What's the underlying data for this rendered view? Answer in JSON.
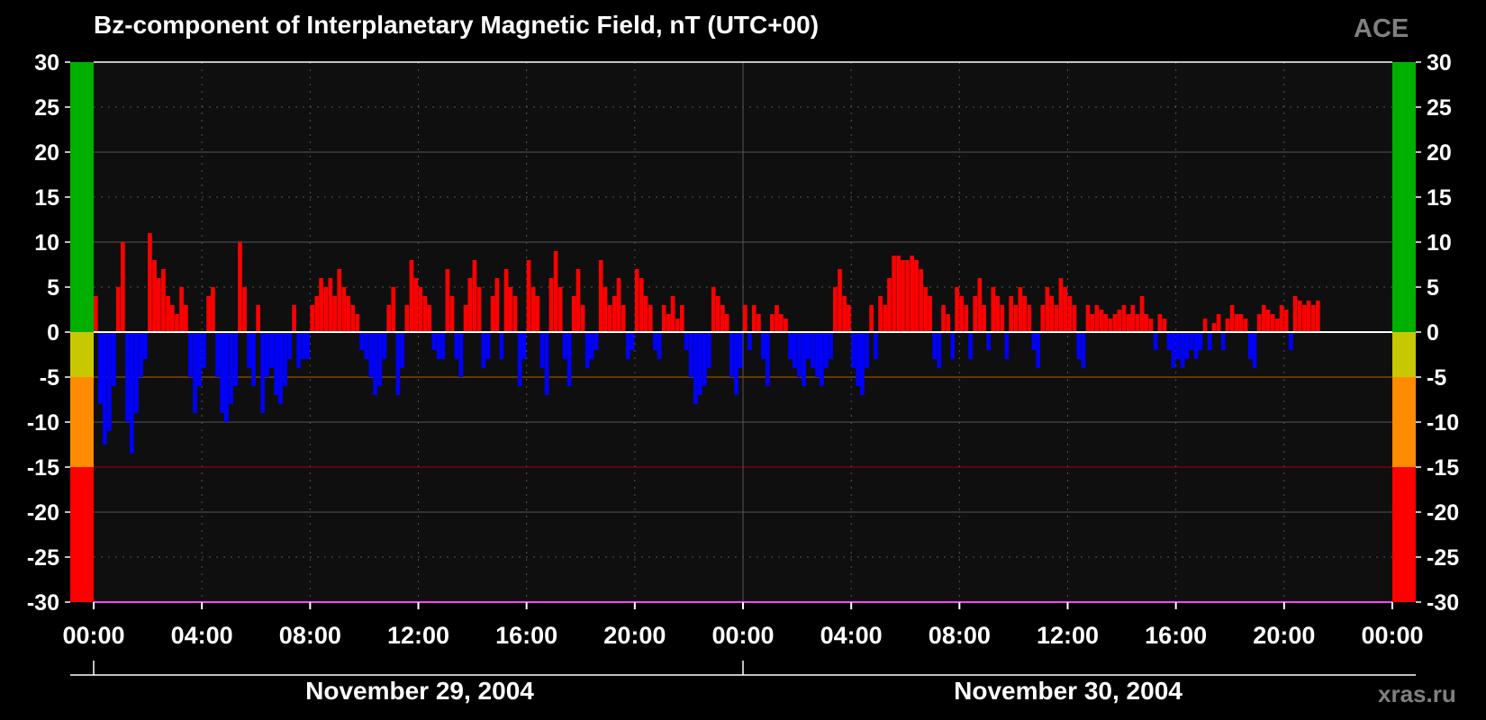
{
  "header": {
    "title": "Bz-component of Interplanetary Magnetic Field, nT (UTC+00)",
    "source": "ACE"
  },
  "footer": {
    "credit": "xras.ru"
  },
  "colors": {
    "background": "#000000",
    "plot_background": "#0f0f0f",
    "positive": "#ff0000",
    "negative": "#0000ff",
    "zero_line": "#ffffff",
    "grid": "#555555",
    "band_quiet": "#00b000",
    "band_weak": "#c8c800",
    "band_moderate": "#ff8c00",
    "band_strong": "#ff0000",
    "threshold_minus5": "#b06000",
    "threshold_minus15": "#a00000",
    "muted_text": "#808080"
  },
  "chart_data": {
    "type": "bar",
    "title": "Bz-component of Interplanetary Magnetic Field, nT (UTC+00)",
    "ylabel": "",
    "xlabel": "",
    "ylim": [
      -30,
      30
    ],
    "yticks": [
      "30",
      "25",
      "20",
      "15",
      "10",
      "5",
      "0",
      "-5",
      "-10",
      "-15",
      "-20",
      "-25",
      "-30"
    ],
    "y_tick_values": [
      30,
      25,
      20,
      15,
      10,
      5,
      0,
      -5,
      -10,
      -15,
      -20,
      -25,
      -30
    ],
    "xlim_hours": [
      0,
      48
    ],
    "xticks": [
      "00:00",
      "04:00",
      "08:00",
      "12:00",
      "16:00",
      "20:00",
      "00:00",
      "04:00",
      "08:00",
      "12:00",
      "16:00",
      "20:00",
      "00:00"
    ],
    "x_tick_hours": [
      0,
      4,
      8,
      12,
      16,
      20,
      24,
      28,
      32,
      36,
      40,
      44,
      48
    ],
    "dates": [
      {
        "label": "November 29, 2004",
        "start_hour": 0,
        "end_hour": 24
      },
      {
        "label": "November 30, 2004",
        "start_hour": 24,
        "end_hour": 48
      }
    ],
    "threshold_bands": [
      {
        "from": 0,
        "to": 30,
        "color": "#00b000"
      },
      {
        "from": -5,
        "to": 0,
        "color": "#c8c800"
      },
      {
        "from": -15,
        "to": -5,
        "color": "#ff8c00"
      },
      {
        "from": -30,
        "to": -15,
        "color": "#ff0000"
      }
    ],
    "grid": true,
    "legend": "none",
    "interval_minutes": 10,
    "series": [
      {
        "x_hours": [
          0.0,
          0.17,
          0.33,
          0.5,
          0.67,
          0.83,
          1.0,
          1.17,
          1.33,
          1.5,
          1.67,
          1.83,
          2.0,
          2.17,
          2.33,
          2.5,
          2.67,
          2.83,
          3.0,
          3.17,
          3.33,
          3.5,
          3.67,
          3.83,
          4.0,
          4.17,
          4.33,
          4.5,
          4.67,
          4.83,
          5.0,
          5.17,
          5.33,
          5.5,
          5.67,
          5.83,
          6.0,
          6.17,
          6.33,
          6.5,
          6.67,
          6.83,
          7.0,
          7.17,
          7.33,
          7.5,
          7.67,
          7.83,
          8.0,
          8.17,
          8.33,
          8.5,
          8.67,
          8.83,
          9.0,
          9.17,
          9.33,
          9.5,
          9.67,
          9.83,
          10.0,
          10.17,
          10.33,
          10.5,
          10.67,
          10.83,
          11.0,
          11.17,
          11.33,
          11.5,
          11.67,
          11.83,
          12.0,
          12.17,
          12.33,
          12.5,
          12.67,
          12.83,
          13.0,
          13.17,
          13.33,
          13.5,
          13.67,
          13.83,
          14.0,
          14.17,
          14.33,
          14.5,
          14.67,
          14.83,
          15.0,
          15.17,
          15.33,
          15.5,
          15.67,
          15.83,
          16.0,
          16.17,
          16.33,
          16.5,
          16.67,
          16.83,
          17.0,
          17.17,
          17.33,
          17.5,
          17.67,
          17.83,
          18.0,
          18.17,
          18.33,
          18.5,
          18.67,
          18.83,
          19.0,
          19.17,
          19.33,
          19.5,
          19.67,
          19.83,
          20.0,
          20.17,
          20.33,
          20.5,
          20.67,
          20.83,
          21.0,
          21.17,
          21.33,
          21.5,
          21.67,
          21.83,
          22.0,
          22.17,
          22.33,
          22.5,
          22.67,
          22.83,
          23.0,
          23.17,
          23.33,
          23.5,
          23.67,
          23.83,
          24.0,
          24.17,
          24.33,
          24.5,
          24.67,
          24.83,
          25.0,
          25.17,
          25.33,
          25.5,
          25.67,
          25.83,
          26.0,
          26.17,
          26.33,
          26.5,
          26.67,
          26.83,
          27.0,
          27.17,
          27.33,
          27.5,
          27.67,
          27.83,
          28.0,
          28.17,
          28.33,
          28.5,
          28.67,
          28.83,
          29.0,
          29.17,
          29.33,
          29.5,
          29.67,
          29.83,
          30.0,
          30.17,
          30.33,
          30.5,
          30.67,
          30.83,
          31.0,
          31.17,
          31.33,
          31.5,
          31.67,
          31.83,
          32.0,
          32.17,
          32.33,
          32.5,
          32.67,
          32.83,
          33.0,
          33.17,
          33.33,
          33.5,
          33.67,
          33.83,
          34.0,
          34.17,
          34.33,
          34.5,
          34.67,
          34.83,
          35.0,
          35.17,
          35.33,
          35.5,
          35.67,
          35.83,
          36.0,
          36.17,
          36.33,
          36.5,
          36.67,
          36.83,
          37.0,
          37.17,
          37.33,
          37.5,
          37.67,
          37.83,
          38.0,
          38.17,
          38.33,
          38.5,
          38.67,
          38.83,
          39.0,
          39.17,
          39.33,
          39.5,
          39.67,
          39.83,
          40.0,
          40.17,
          40.33,
          40.5,
          40.67,
          40.83,
          41.0,
          41.17,
          41.33,
          41.5,
          41.67,
          41.83,
          42.0,
          42.17,
          42.33,
          42.5,
          42.67,
          42.83,
          43.0,
          43.17,
          43.33,
          43.5,
          43.67,
          43.83,
          44.0,
          44.17,
          44.33,
          44.5,
          44.67,
          44.83,
          45.0,
          45.17,
          45.33,
          45.5,
          45.67,
          45.83,
          46.0,
          46.17,
          46.33,
          46.5,
          46.67,
          46.83,
          47.0,
          47.17,
          47.33,
          47.5,
          47.67,
          47.83
        ],
        "bz": [
          4.0,
          -8.0,
          -12.5,
          -11.0,
          -6.0,
          5.0,
          10.0,
          -10.0,
          -13.5,
          -9.0,
          -5.0,
          -3.0,
          11.0,
          8.0,
          6.0,
          7.0,
          4.0,
          3.0,
          2.0,
          5.0,
          3.0,
          -5.0,
          -9.0,
          -6.0,
          -4.0,
          4.0,
          5.0,
          -5.0,
          -9.0,
          -10.0,
          -8.0,
          -6.0,
          10.0,
          5.0,
          -4.0,
          -6.0,
          3.0,
          -9.0,
          -5.0,
          -4.0,
          -7.0,
          -8.0,
          -6.0,
          -3.0,
          3.0,
          -4.0,
          -3.0,
          -3.0,
          3.0,
          4.0,
          6.0,
          5.0,
          6.0,
          4.0,
          7.0,
          5.0,
          4.0,
          3.0,
          2.0,
          -2.0,
          -3.0,
          -5.0,
          -7.0,
          -6.0,
          -3.0,
          3.0,
          5.0,
          -7.0,
          -4.0,
          3.0,
          8.0,
          6.0,
          5.0,
          4.0,
          3.0,
          -2.0,
          -3.0,
          -3.0,
          7.0,
          4.0,
          -3.0,
          -5.0,
          3.0,
          6.0,
          8.0,
          5.0,
          -4.0,
          -3.0,
          4.0,
          6.0,
          -3.0,
          7.0,
          5.0,
          4.0,
          -6.0,
          -3.0,
          8.0,
          5.0,
          4.0,
          -4.0,
          -7.0,
          6.0,
          9.0,
          5.0,
          -3.0,
          -6.0,
          4.0,
          7.0,
          3.0,
          -4.0,
          -3.0,
          -2.0,
          8.0,
          5.0,
          3.0,
          4.0,
          6.0,
          3.0,
          -3.0,
          -2.0,
          7.0,
          6.0,
          4.0,
          3.0,
          -2.0,
          -3.0,
          3.0,
          2.0,
          4.0,
          1.5,
          3.0,
          -2.0,
          -5.0,
          -8.0,
          -7.0,
          -6.0,
          -4.0,
          5.0,
          4.0,
          3.0,
          2.0,
          -5.0,
          -7.0,
          -4.0,
          3.0,
          -2.0,
          3.0,
          2.0,
          -3.0,
          -6.0,
          2.0,
          3.0,
          2.0,
          1.5,
          -3.0,
          -4.0,
          -5.0,
          -6.0,
          -3.0,
          -4.0,
          -5.0,
          -6.0,
          -4.0,
          -3.0,
          5.0,
          7.0,
          4.0,
          3.0,
          -4.0,
          -6.0,
          -7.0,
          -4.0,
          3.0,
          -3.0,
          4.0,
          3.0,
          6.0,
          8.5,
          8.5,
          8.0,
          8.0,
          8.5,
          8.0,
          7.0,
          5.0,
          4.0,
          -3.0,
          -4.0,
          3.0,
          2.0,
          -3.0,
          5.0,
          4.0,
          3.0,
          -3.0,
          4.0,
          6.0,
          3.0,
          -2.0,
          5.0,
          4.0,
          3.0,
          -3.0,
          4.0,
          3.0,
          5.0,
          4.0,
          3.0,
          -2.0,
          -4.0,
          3.0,
          5.0,
          4.0,
          3.0,
          6.0,
          5.0,
          4.0,
          3.0,
          -3.0,
          -4.0,
          3.0,
          2.0,
          3.0,
          2.5,
          2.0,
          1.5,
          2.0,
          2.5,
          3.0,
          2.0,
          3.0,
          2.0,
          4.0,
          2.0,
          1.5,
          -2.0,
          2.0,
          1.5,
          -2.0,
          -4.0,
          -3.0,
          -4.0,
          -3.0,
          -2.0,
          -3.0,
          -2.0,
          1.5,
          -2.0,
          1.0,
          2.0,
          -2.0,
          1.5,
          3.0,
          2.0,
          2.0,
          1.5,
          -3.0,
          -4.0,
          2.0,
          3.0,
          2.5,
          2.0,
          1.5,
          3.0,
          2.5,
          -2.0,
          4.0,
          3.5,
          3.0,
          3.5,
          3.0,
          3.5
        ]
      }
    ]
  }
}
